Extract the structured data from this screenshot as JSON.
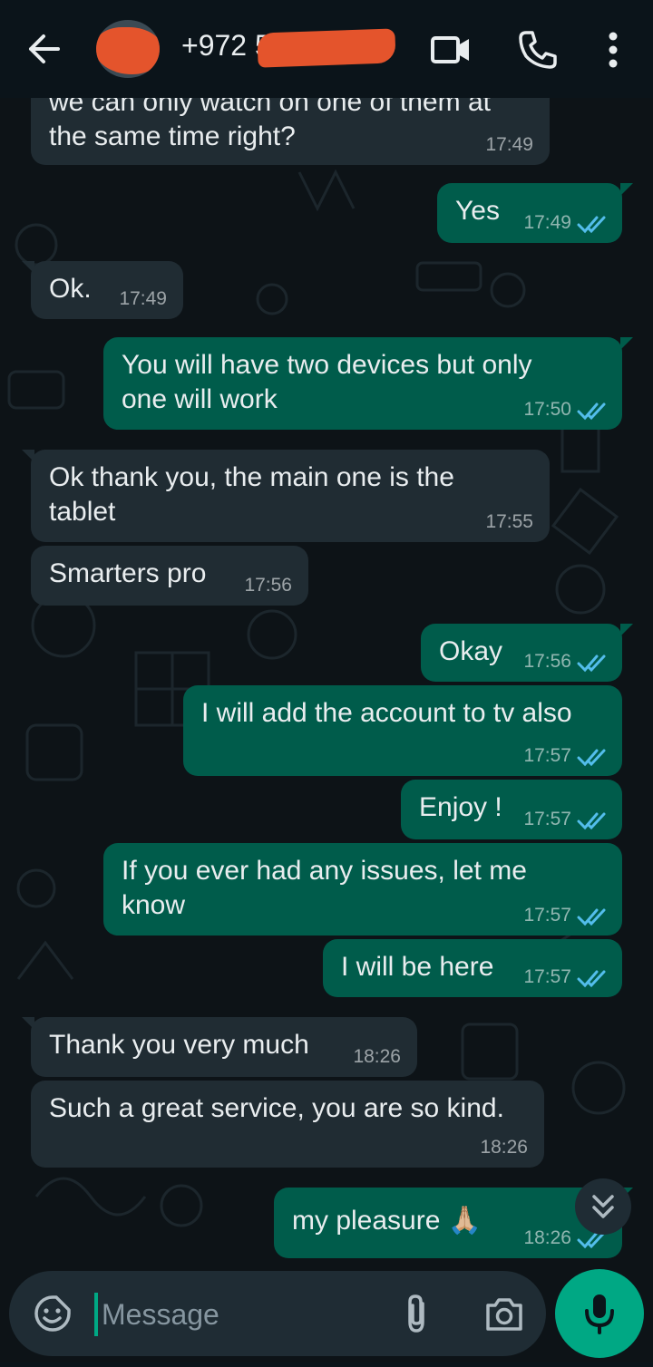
{
  "header": {
    "contact_name": "+972 5",
    "icons": [
      "back-arrow-icon",
      "video-call-icon",
      "phone-icon",
      "more-vert-icon"
    ]
  },
  "messages": [
    {
      "direction": "in",
      "lines": [
        "we can only watch on one of them at",
        "the same time right?"
      ],
      "time": "17:49"
    },
    {
      "direction": "out",
      "lines": [
        "Yes"
      ],
      "time": "17:49",
      "read": true
    },
    {
      "direction": "in",
      "lines": [
        "Ok."
      ],
      "time": "17:49"
    },
    {
      "direction": "out",
      "lines": [
        "You will have two devices but only",
        "one will work"
      ],
      "time": "17:50",
      "read": true
    },
    {
      "direction": "in",
      "lines": [
        "Ok thank you, the main one is the",
        "tablet"
      ],
      "time": "17:55"
    },
    {
      "direction": "in",
      "lines": [
        "Smarters pro"
      ],
      "time": "17:56"
    },
    {
      "direction": "out",
      "lines": [
        "Okay"
      ],
      "time": "17:56",
      "read": true
    },
    {
      "direction": "out",
      "lines": [
        "I will add the account to tv also"
      ],
      "time": "17:57",
      "read": true
    },
    {
      "direction": "out",
      "lines": [
        "Enjoy !"
      ],
      "time": "17:57",
      "read": true
    },
    {
      "direction": "out",
      "lines": [
        "If you ever had any issues, let me",
        "know"
      ],
      "time": "17:57",
      "read": true
    },
    {
      "direction": "out",
      "lines": [
        "I will be here"
      ],
      "time": "17:57",
      "read": true
    },
    {
      "direction": "in",
      "lines": [
        "Thank you very much"
      ],
      "time": "18:26"
    },
    {
      "direction": "in",
      "lines": [
        "Such a great service, you are so kind."
      ],
      "time": "18:26"
    },
    {
      "direction": "out",
      "lines": [
        "my pleasure 🙏🏼"
      ],
      "time": "18:26",
      "read": true
    }
  ],
  "input": {
    "placeholder": "Message"
  },
  "colors": {
    "incoming": "#202c33",
    "outgoing": "#005c4b",
    "accent": "#00a884",
    "read_tick": "#53bdeb"
  }
}
